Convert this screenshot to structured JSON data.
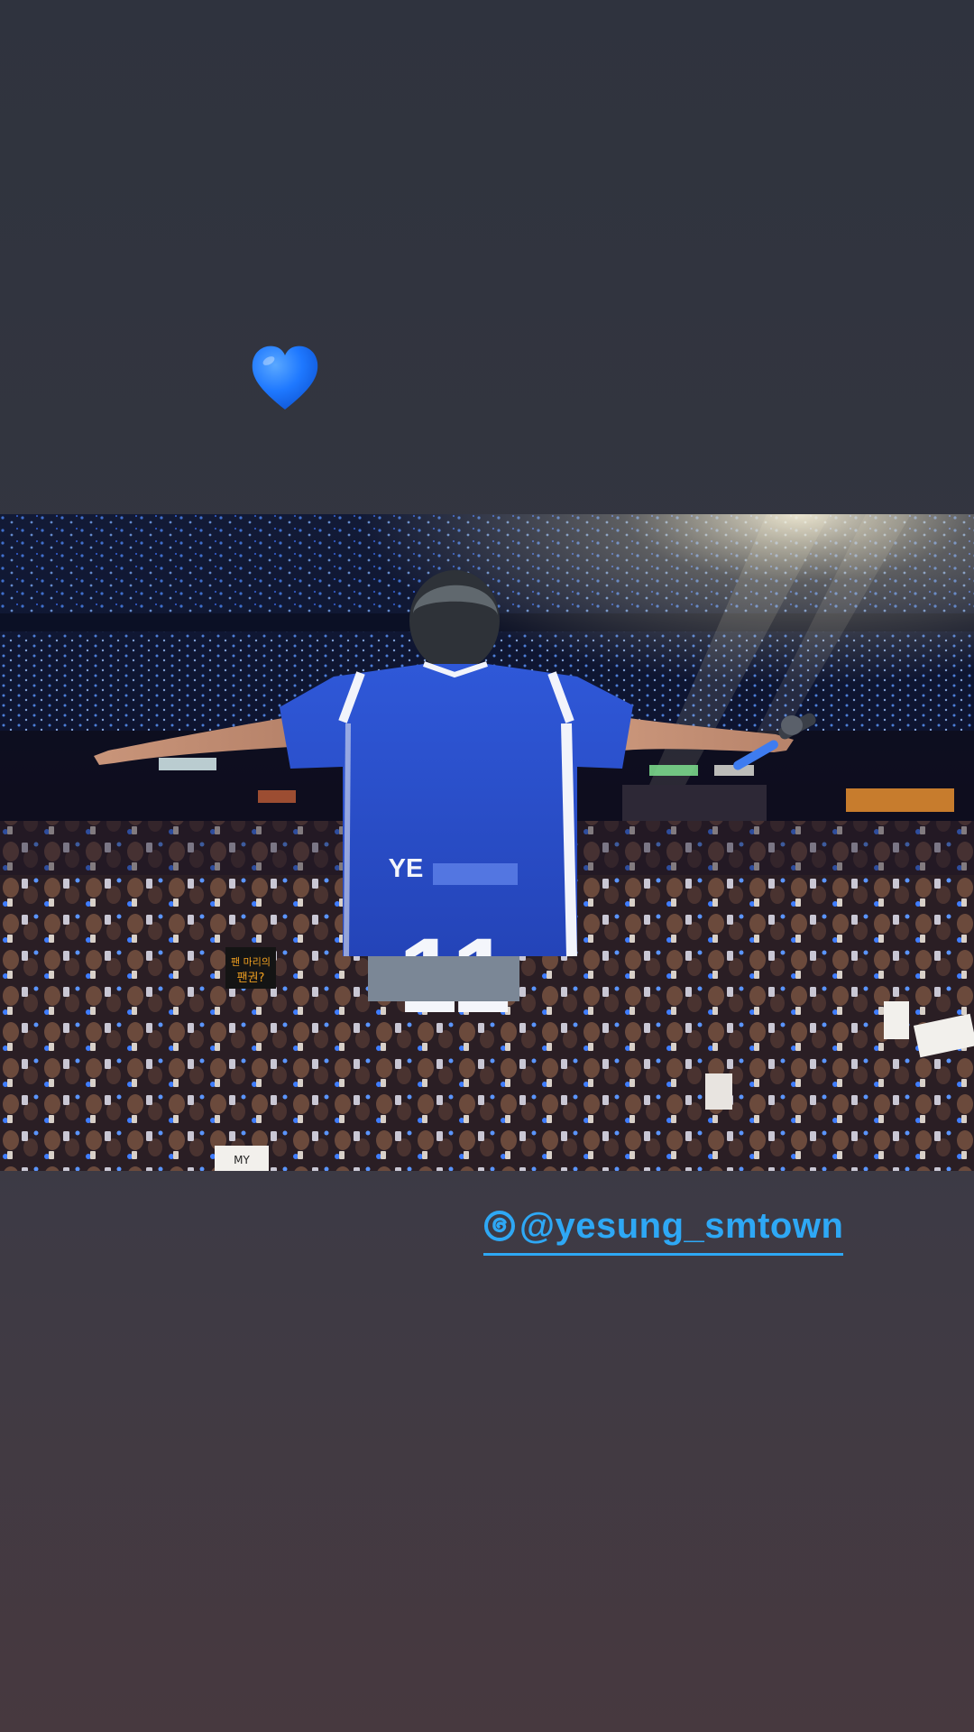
{
  "story": {
    "sticker_emoji": "heart",
    "sticker_color": "#1e78ff",
    "background_top": "#2f333e",
    "background_bottom": "#47393f"
  },
  "photo": {
    "description_icon": "concert-photo",
    "jersey": {
      "name_prefix": "YE",
      "number": "11",
      "color": "#2a4fd0"
    },
    "fan_sign": "MY"
  },
  "mention": {
    "handle": "@yesung_smtown",
    "icon": "threads-icon",
    "color": "#2ea8f5"
  }
}
